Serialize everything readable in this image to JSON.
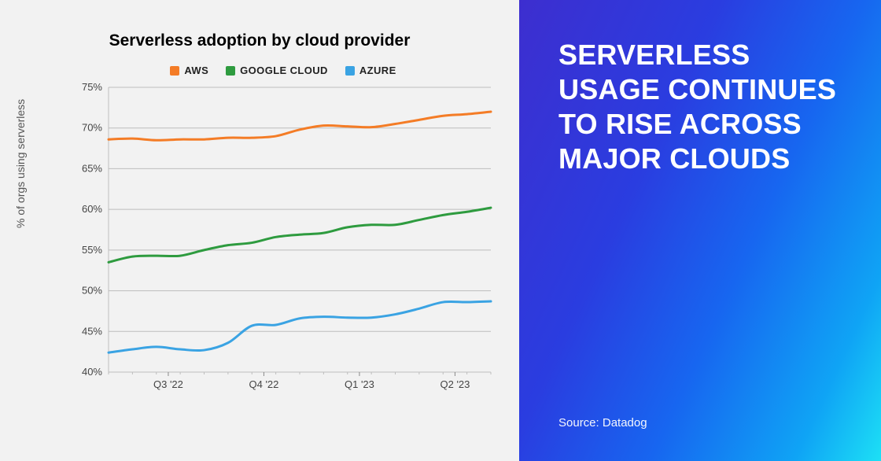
{
  "headline": "SERVERLESS USAGE CONTINUES TO RISE ACROSS MAJOR CLOUDS",
  "source": "Source: Datadog",
  "chart_data": {
    "type": "line",
    "title": "Serverless adoption by cloud provider",
    "ylabel": "% of orgs using serverless",
    "xlabel": "",
    "ylim": [
      40,
      75
    ],
    "yticks": [
      40,
      45,
      50,
      55,
      60,
      65,
      70,
      75
    ],
    "ytick_labels": [
      "40%",
      "45%",
      "50%",
      "55%",
      "60%",
      "65%",
      "70%",
      "75%"
    ],
    "x_labels": [
      "Q3 '22",
      "Q4 '22",
      "Q1 '23",
      "Q2 '23"
    ],
    "x_label_positions": [
      2.5,
      6.5,
      10.5,
      14.5
    ],
    "x_count": 17,
    "legend_position": "top",
    "grid": "horizontal",
    "series": [
      {
        "name": "AWS",
        "color": "#f47c26",
        "values": [
          68.6,
          68.7,
          68.5,
          68.6,
          68.6,
          68.8,
          68.8,
          69.0,
          69.8,
          70.3,
          70.2,
          70.1,
          70.5,
          71.0,
          71.5,
          71.7,
          72.0
        ]
      },
      {
        "name": "GOOGLE CLOUD",
        "color": "#2e9b3f",
        "values": [
          53.5,
          54.2,
          54.3,
          54.3,
          55.0,
          55.6,
          55.9,
          56.6,
          56.9,
          57.1,
          57.8,
          58.1,
          58.1,
          58.7,
          59.3,
          59.7,
          60.2
        ]
      },
      {
        "name": "AZURE",
        "color": "#3aa3e3",
        "values": [
          42.4,
          42.8,
          43.1,
          42.8,
          42.7,
          43.6,
          45.7,
          45.8,
          46.6,
          46.8,
          46.7,
          46.7,
          47.1,
          47.8,
          48.6,
          48.6,
          48.7
        ]
      }
    ]
  }
}
